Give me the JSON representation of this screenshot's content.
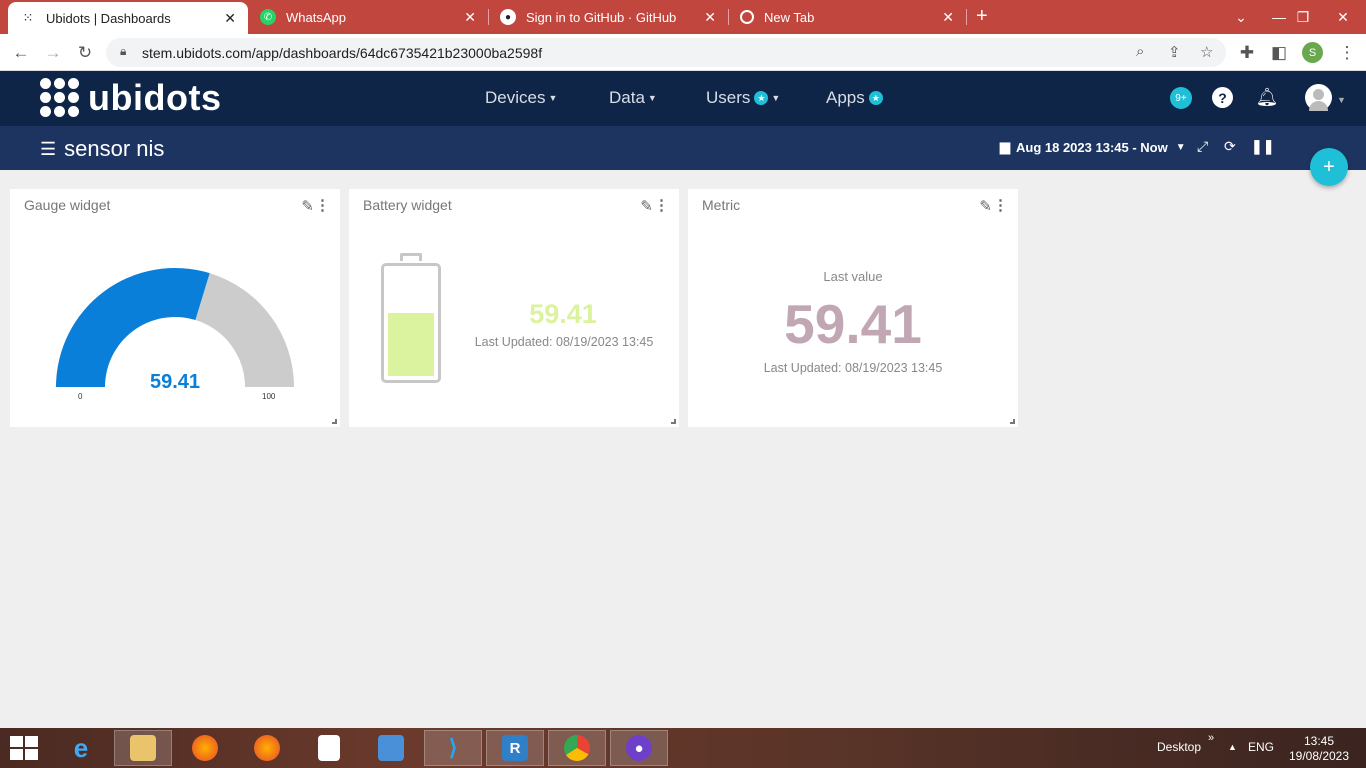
{
  "browser": {
    "tabs": [
      {
        "title": "Ubidots | Dashboards",
        "active": true
      },
      {
        "title": "WhatsApp",
        "active": false
      },
      {
        "title": "Sign in to GitHub · GitHub",
        "active": false
      },
      {
        "title": "New Tab",
        "active": false
      }
    ],
    "url": "stem.ubidots.com/app/dashboards/64dc6735421b23000ba2598f",
    "profile_initial": "S"
  },
  "app": {
    "logo_text": "ubidots",
    "nav": {
      "devices": "Devices",
      "data": "Data",
      "users": "Users",
      "apps": "Apps"
    },
    "notifications_badge": "9+",
    "help_label": "?"
  },
  "dashboard": {
    "title": "sensor nis",
    "date_range": "Aug 18 2023 13:45 - Now"
  },
  "widgets": {
    "gauge": {
      "title": "Gauge widget",
      "value": "59.41",
      "min": "0",
      "max": "100",
      "fraction": 0.5941,
      "color_fill": "#0a7fd9",
      "color_rest": "#cccccc"
    },
    "battery": {
      "title": "Battery widget",
      "value": "59.41",
      "last_updated": "Last Updated: 08/19/2023 13:45",
      "level_fraction": 0.5941,
      "color": "#dbf29e"
    },
    "metric": {
      "title": "Metric",
      "label": "Last value",
      "value": "59.41",
      "last_updated": "Last Updated: 08/19/2023 13:45",
      "color": "#c1a7b3"
    }
  },
  "taskbar": {
    "desktop_label": "Desktop",
    "language": "ENG",
    "time": "13:45",
    "date": "19/08/2023"
  },
  "colors": {
    "navbar": "#0f2547",
    "subheader": "#1d3461",
    "accent": "#1fc0d7",
    "tabstrip": "#c0463e"
  }
}
